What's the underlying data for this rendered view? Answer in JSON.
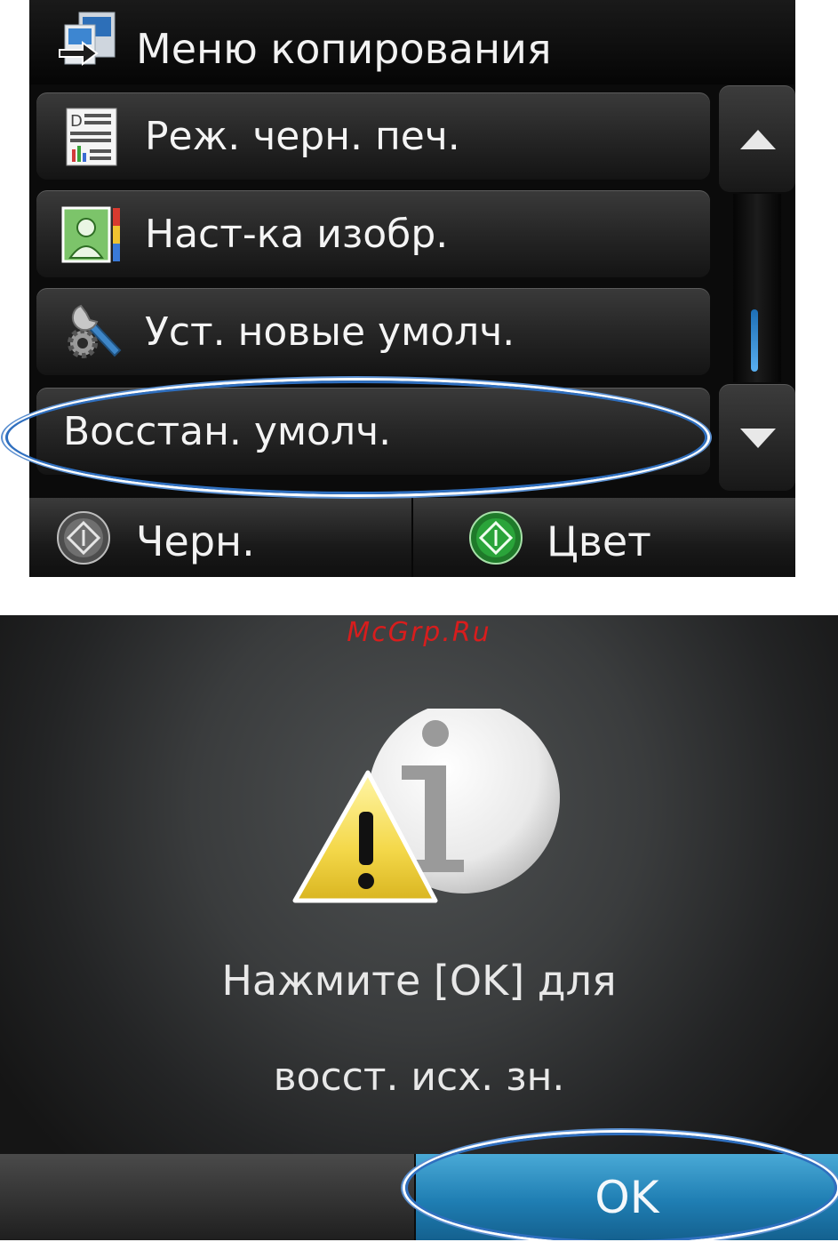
{
  "copy_menu": {
    "title": "Меню копирования",
    "title_icon": "copy-menu-icon",
    "items": [
      {
        "label": "Реж. черн. печ.",
        "icon": "draft-document-icon"
      },
      {
        "label": "Наст-ка изобр.",
        "icon": "image-adjust-icon"
      },
      {
        "label": "Уст. новые умолч.",
        "icon": "tools-settings-icon"
      },
      {
        "label": "Восстан. умолч.",
        "icon": ""
      }
    ],
    "scroll": {
      "up_icon": "chevron-up-icon",
      "down_icon": "chevron-down-icon"
    },
    "start_black_label": "Черн.",
    "start_color_label": "Цвет",
    "colors": {
      "accent": "#2f6fbf",
      "start_black": "#6a6a6a",
      "start_color": "#2aa43a"
    }
  },
  "confirm_dialog": {
    "watermark": "McGrp.Ru",
    "icon": "warning-info-icon",
    "message_line_1": "Нажмите [OK] для",
    "message_line_2": "восст. исх. зн.",
    "ok_label": "OK",
    "colors": {
      "ok_button": "#2a8cc4",
      "watermark": "#d81d1d"
    }
  }
}
